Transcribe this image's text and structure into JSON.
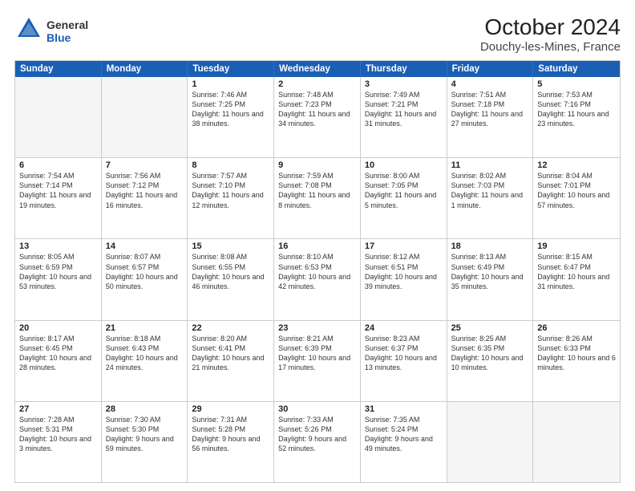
{
  "logo": {
    "general": "General",
    "blue": "Blue"
  },
  "title": "October 2024",
  "subtitle": "Douchy-les-Mines, France",
  "days": [
    "Sunday",
    "Monday",
    "Tuesday",
    "Wednesday",
    "Thursday",
    "Friday",
    "Saturday"
  ],
  "weeks": [
    [
      {
        "day": "",
        "empty": true
      },
      {
        "day": "",
        "empty": true
      },
      {
        "day": "1",
        "sunrise": "Sunrise: 7:46 AM",
        "sunset": "Sunset: 7:25 PM",
        "daylight": "Daylight: 11 hours and 38 minutes."
      },
      {
        "day": "2",
        "sunrise": "Sunrise: 7:48 AM",
        "sunset": "Sunset: 7:23 PM",
        "daylight": "Daylight: 11 hours and 34 minutes."
      },
      {
        "day": "3",
        "sunrise": "Sunrise: 7:49 AM",
        "sunset": "Sunset: 7:21 PM",
        "daylight": "Daylight: 11 hours and 31 minutes."
      },
      {
        "day": "4",
        "sunrise": "Sunrise: 7:51 AM",
        "sunset": "Sunset: 7:18 PM",
        "daylight": "Daylight: 11 hours and 27 minutes."
      },
      {
        "day": "5",
        "sunrise": "Sunrise: 7:53 AM",
        "sunset": "Sunset: 7:16 PM",
        "daylight": "Daylight: 11 hours and 23 minutes."
      }
    ],
    [
      {
        "day": "6",
        "sunrise": "Sunrise: 7:54 AM",
        "sunset": "Sunset: 7:14 PM",
        "daylight": "Daylight: 11 hours and 19 minutes."
      },
      {
        "day": "7",
        "sunrise": "Sunrise: 7:56 AM",
        "sunset": "Sunset: 7:12 PM",
        "daylight": "Daylight: 11 hours and 16 minutes."
      },
      {
        "day": "8",
        "sunrise": "Sunrise: 7:57 AM",
        "sunset": "Sunset: 7:10 PM",
        "daylight": "Daylight: 11 hours and 12 minutes."
      },
      {
        "day": "9",
        "sunrise": "Sunrise: 7:59 AM",
        "sunset": "Sunset: 7:08 PM",
        "daylight": "Daylight: 11 hours and 8 minutes."
      },
      {
        "day": "10",
        "sunrise": "Sunrise: 8:00 AM",
        "sunset": "Sunset: 7:05 PM",
        "daylight": "Daylight: 11 hours and 5 minutes."
      },
      {
        "day": "11",
        "sunrise": "Sunrise: 8:02 AM",
        "sunset": "Sunset: 7:03 PM",
        "daylight": "Daylight: 11 hours and 1 minute."
      },
      {
        "day": "12",
        "sunrise": "Sunrise: 8:04 AM",
        "sunset": "Sunset: 7:01 PM",
        "daylight": "Daylight: 10 hours and 57 minutes."
      }
    ],
    [
      {
        "day": "13",
        "sunrise": "Sunrise: 8:05 AM",
        "sunset": "Sunset: 6:59 PM",
        "daylight": "Daylight: 10 hours and 53 minutes."
      },
      {
        "day": "14",
        "sunrise": "Sunrise: 8:07 AM",
        "sunset": "Sunset: 6:57 PM",
        "daylight": "Daylight: 10 hours and 50 minutes."
      },
      {
        "day": "15",
        "sunrise": "Sunrise: 8:08 AM",
        "sunset": "Sunset: 6:55 PM",
        "daylight": "Daylight: 10 hours and 46 minutes."
      },
      {
        "day": "16",
        "sunrise": "Sunrise: 8:10 AM",
        "sunset": "Sunset: 6:53 PM",
        "daylight": "Daylight: 10 hours and 42 minutes."
      },
      {
        "day": "17",
        "sunrise": "Sunrise: 8:12 AM",
        "sunset": "Sunset: 6:51 PM",
        "daylight": "Daylight: 10 hours and 39 minutes."
      },
      {
        "day": "18",
        "sunrise": "Sunrise: 8:13 AM",
        "sunset": "Sunset: 6:49 PM",
        "daylight": "Daylight: 10 hours and 35 minutes."
      },
      {
        "day": "19",
        "sunrise": "Sunrise: 8:15 AM",
        "sunset": "Sunset: 6:47 PM",
        "daylight": "Daylight: 10 hours and 31 minutes."
      }
    ],
    [
      {
        "day": "20",
        "sunrise": "Sunrise: 8:17 AM",
        "sunset": "Sunset: 6:45 PM",
        "daylight": "Daylight: 10 hours and 28 minutes."
      },
      {
        "day": "21",
        "sunrise": "Sunrise: 8:18 AM",
        "sunset": "Sunset: 6:43 PM",
        "daylight": "Daylight: 10 hours and 24 minutes."
      },
      {
        "day": "22",
        "sunrise": "Sunrise: 8:20 AM",
        "sunset": "Sunset: 6:41 PM",
        "daylight": "Daylight: 10 hours and 21 minutes."
      },
      {
        "day": "23",
        "sunrise": "Sunrise: 8:21 AM",
        "sunset": "Sunset: 6:39 PM",
        "daylight": "Daylight: 10 hours and 17 minutes."
      },
      {
        "day": "24",
        "sunrise": "Sunrise: 8:23 AM",
        "sunset": "Sunset: 6:37 PM",
        "daylight": "Daylight: 10 hours and 13 minutes."
      },
      {
        "day": "25",
        "sunrise": "Sunrise: 8:25 AM",
        "sunset": "Sunset: 6:35 PM",
        "daylight": "Daylight: 10 hours and 10 minutes."
      },
      {
        "day": "26",
        "sunrise": "Sunrise: 8:26 AM",
        "sunset": "Sunset: 6:33 PM",
        "daylight": "Daylight: 10 hours and 6 minutes."
      }
    ],
    [
      {
        "day": "27",
        "sunrise": "Sunrise: 7:28 AM",
        "sunset": "Sunset: 5:31 PM",
        "daylight": "Daylight: 10 hours and 3 minutes."
      },
      {
        "day": "28",
        "sunrise": "Sunrise: 7:30 AM",
        "sunset": "Sunset: 5:30 PM",
        "daylight": "Daylight: 9 hours and 59 minutes."
      },
      {
        "day": "29",
        "sunrise": "Sunrise: 7:31 AM",
        "sunset": "Sunset: 5:28 PM",
        "daylight": "Daylight: 9 hours and 56 minutes."
      },
      {
        "day": "30",
        "sunrise": "Sunrise: 7:33 AM",
        "sunset": "Sunset: 5:26 PM",
        "daylight": "Daylight: 9 hours and 52 minutes."
      },
      {
        "day": "31",
        "sunrise": "Sunrise: 7:35 AM",
        "sunset": "Sunset: 5:24 PM",
        "daylight": "Daylight: 9 hours and 49 minutes."
      },
      {
        "day": "",
        "empty": true
      },
      {
        "day": "",
        "empty": true
      }
    ]
  ]
}
